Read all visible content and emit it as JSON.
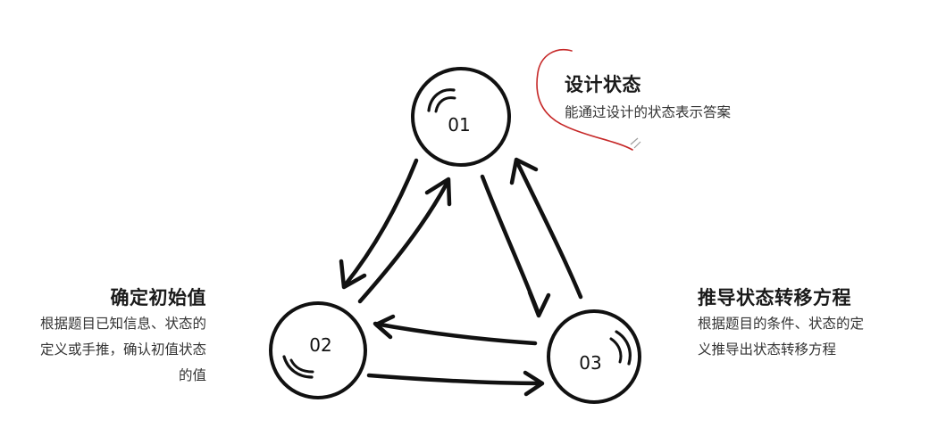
{
  "nodes": [
    {
      "id": "01",
      "label": "01"
    },
    {
      "id": "02",
      "label": "02"
    },
    {
      "id": "03",
      "label": "03"
    }
  ],
  "steps": {
    "design_state": {
      "title": "设计状态",
      "description": "能通过设计的状态表示答案"
    },
    "init_value": {
      "title": "确定初始值",
      "lines": [
        "根据题目已知信息、状态的",
        "定义或手推，确认初值状态",
        "的值"
      ]
    },
    "transition": {
      "title": "推导状态转移方程",
      "lines": [
        "根据题目的条件、状态的定",
        "义推导出状态转移方程"
      ]
    },
    "colors": {
      "ink": "#111111",
      "annotation": "#c62828"
    }
  }
}
